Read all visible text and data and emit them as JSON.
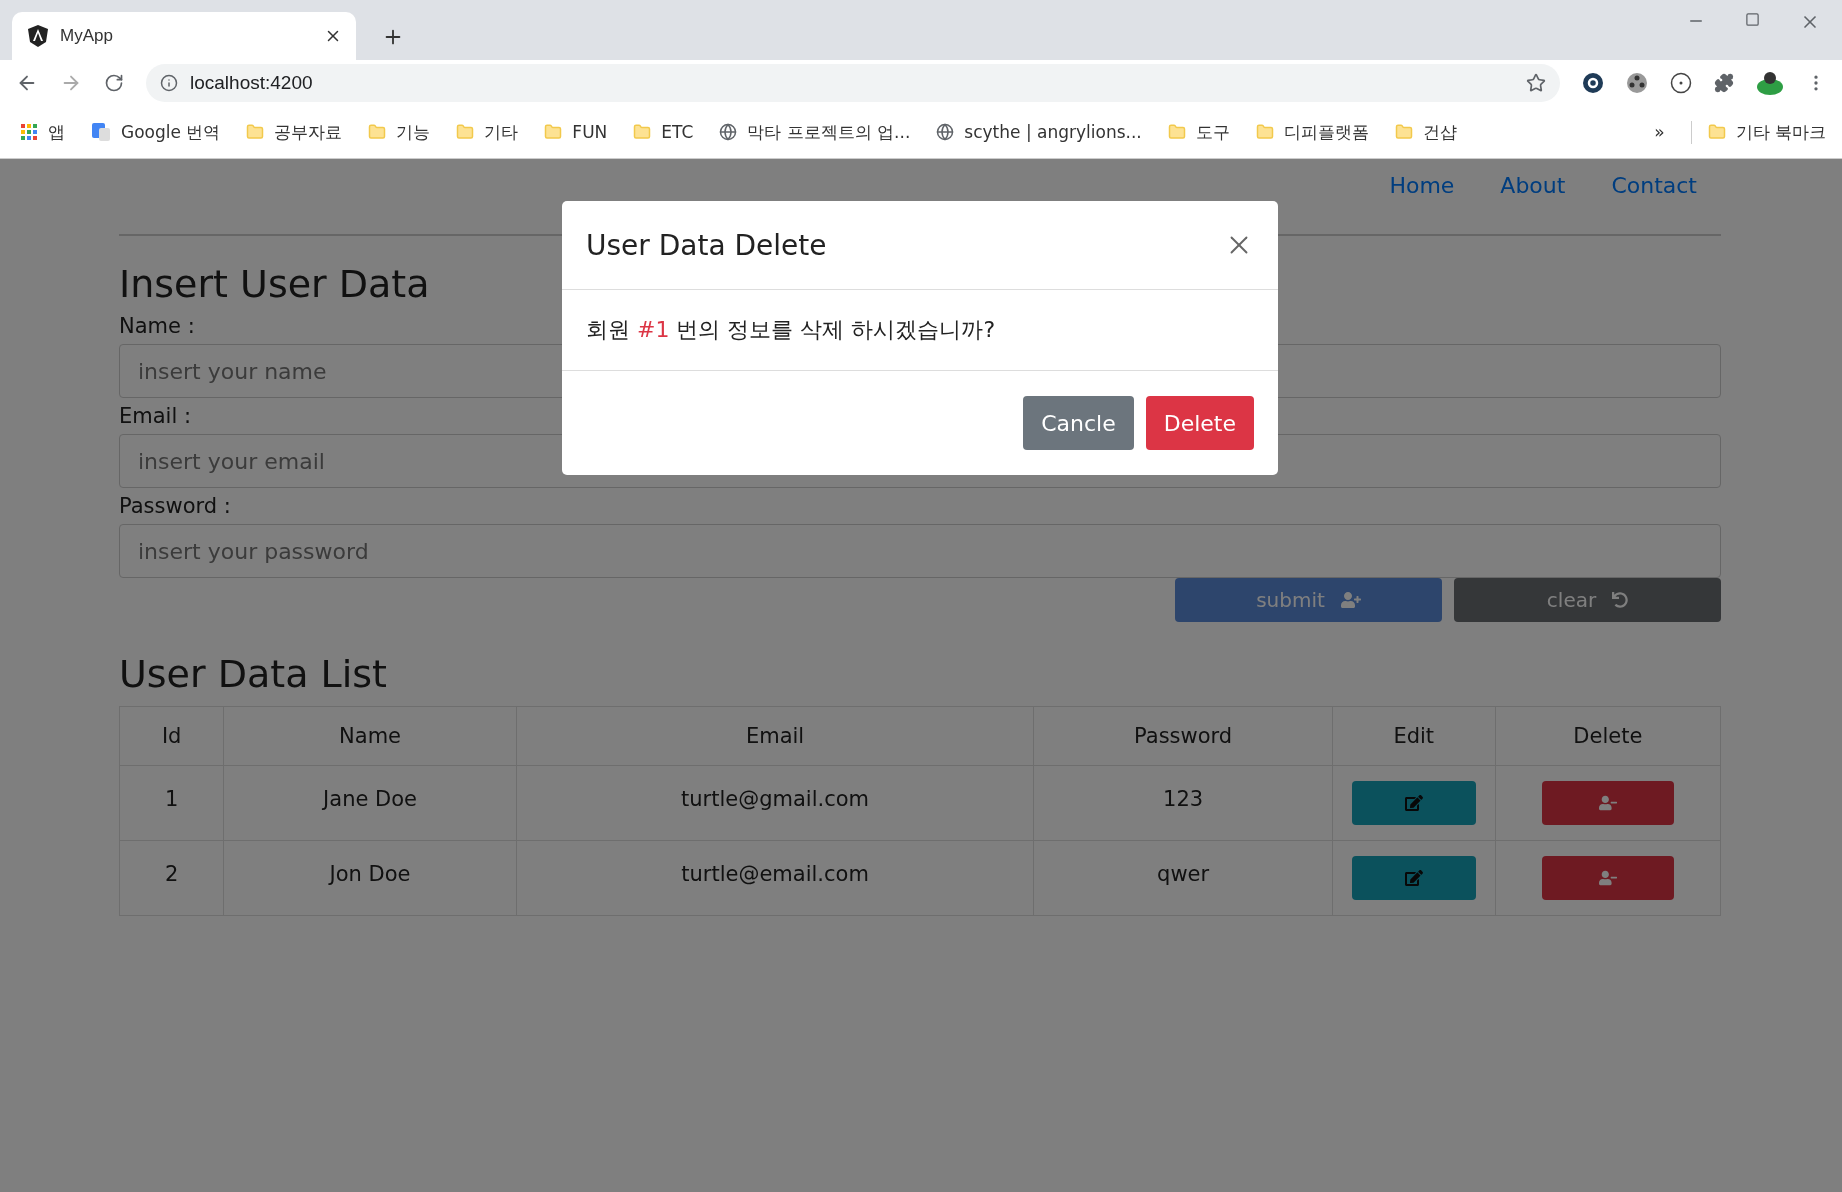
{
  "browser": {
    "tab": {
      "title": "MyApp"
    },
    "address": "localhost:4200",
    "bookmarks": [
      {
        "kind": "apps",
        "label": "앱"
      },
      {
        "kind": "translate",
        "label": "Google 번역"
      },
      {
        "kind": "folder",
        "label": "공부자료"
      },
      {
        "kind": "folder",
        "label": "기능"
      },
      {
        "kind": "folder",
        "label": "기타"
      },
      {
        "kind": "folder",
        "label": "FUN"
      },
      {
        "kind": "folder",
        "label": "ETC"
      },
      {
        "kind": "globe",
        "label": "막타 프로젝트의 업..."
      },
      {
        "kind": "globe",
        "label": "scythe | angrylions..."
      },
      {
        "kind": "folder",
        "label": "도구"
      },
      {
        "kind": "folder",
        "label": "디피플랫폼"
      },
      {
        "kind": "folder",
        "label": "건샵"
      }
    ],
    "more": "»",
    "other_bookmarks": "기타 북마크"
  },
  "nav": [
    "Home",
    "About",
    "Contact"
  ],
  "form": {
    "title": "Insert User Data",
    "fields": [
      {
        "label": "Name :",
        "placeholder": "insert your name"
      },
      {
        "label": "Email :",
        "placeholder": "insert your email"
      },
      {
        "label": "Password :",
        "placeholder": "insert your password"
      }
    ],
    "buttons": [
      {
        "kind": "submit",
        "label": "submit"
      },
      {
        "kind": "clear",
        "label": "clear"
      }
    ]
  },
  "list": {
    "title": "User Data List",
    "columns": [
      "Id",
      "Name",
      "Email",
      "Password",
      "Edit",
      "Delete"
    ],
    "rows": [
      [
        "1",
        "Jane Doe",
        "turtle@gmail.com",
        "123"
      ],
      [
        "2",
        "Jon Doe",
        "turtle@email.com",
        "qwer"
      ]
    ]
  },
  "modal": {
    "title": "User Data Delete",
    "message": "회원 **#1** 번의 정보를 삭제 하시겠습니까?",
    "buttons": [
      {
        "kind": "cancel",
        "label": "Cancle"
      },
      {
        "kind": "delete",
        "label": "Delete"
      }
    ]
  }
}
